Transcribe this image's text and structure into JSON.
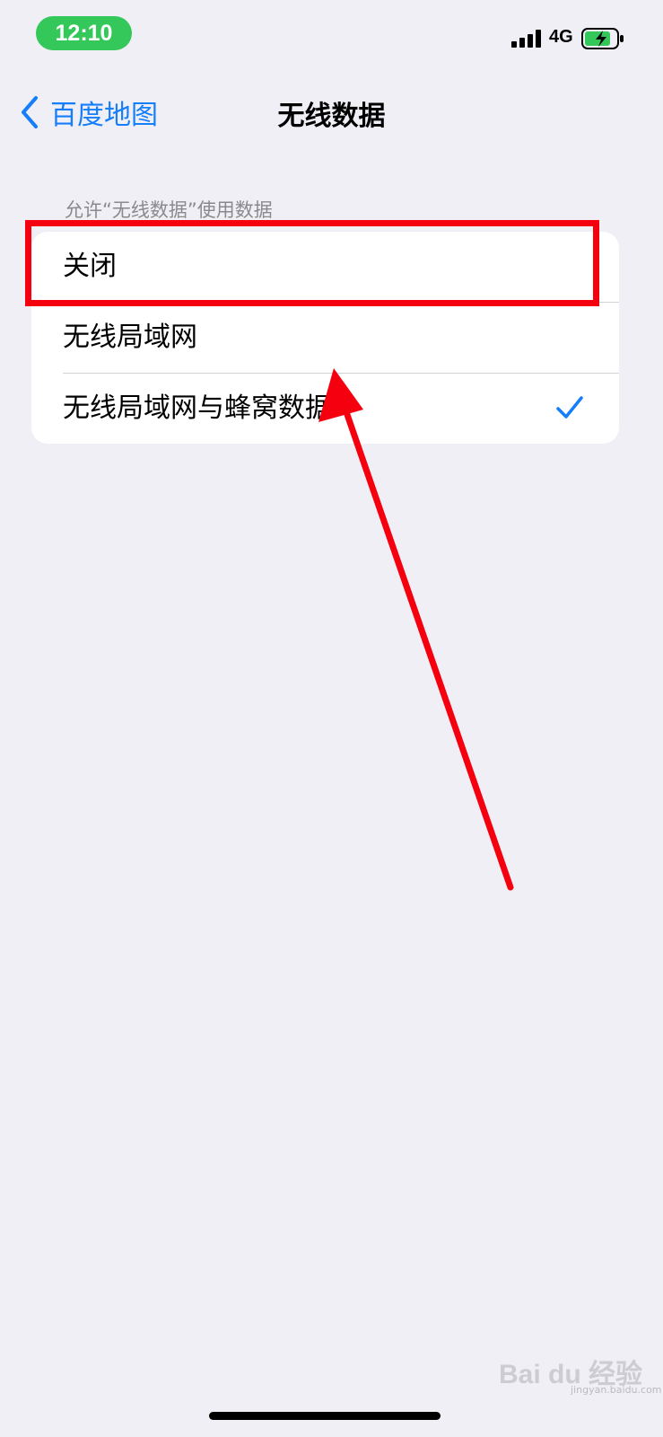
{
  "status_bar": {
    "time": "12:10",
    "network": "4G",
    "signal_icon": "cellular-signal-icon",
    "battery_icon": "battery-charging-icon"
  },
  "nav": {
    "back_label": "百度地图",
    "title": "无线数据",
    "back_icon": "chevron-left-icon"
  },
  "section": {
    "header": "允许“无线数据”使用数据",
    "options": [
      {
        "label": "关闭",
        "selected": false
      },
      {
        "label": "无线局域网",
        "selected": false
      },
      {
        "label": "无线局域网与蜂窝数据",
        "selected": true
      }
    ]
  },
  "watermark": {
    "text": "Bai du 经验",
    "sub": "jingyan.baidu.com"
  },
  "colors": {
    "accent": "#157efb",
    "status_green": "#34c759",
    "annotation_red": "#f4000f",
    "background": "#f0eff5"
  }
}
